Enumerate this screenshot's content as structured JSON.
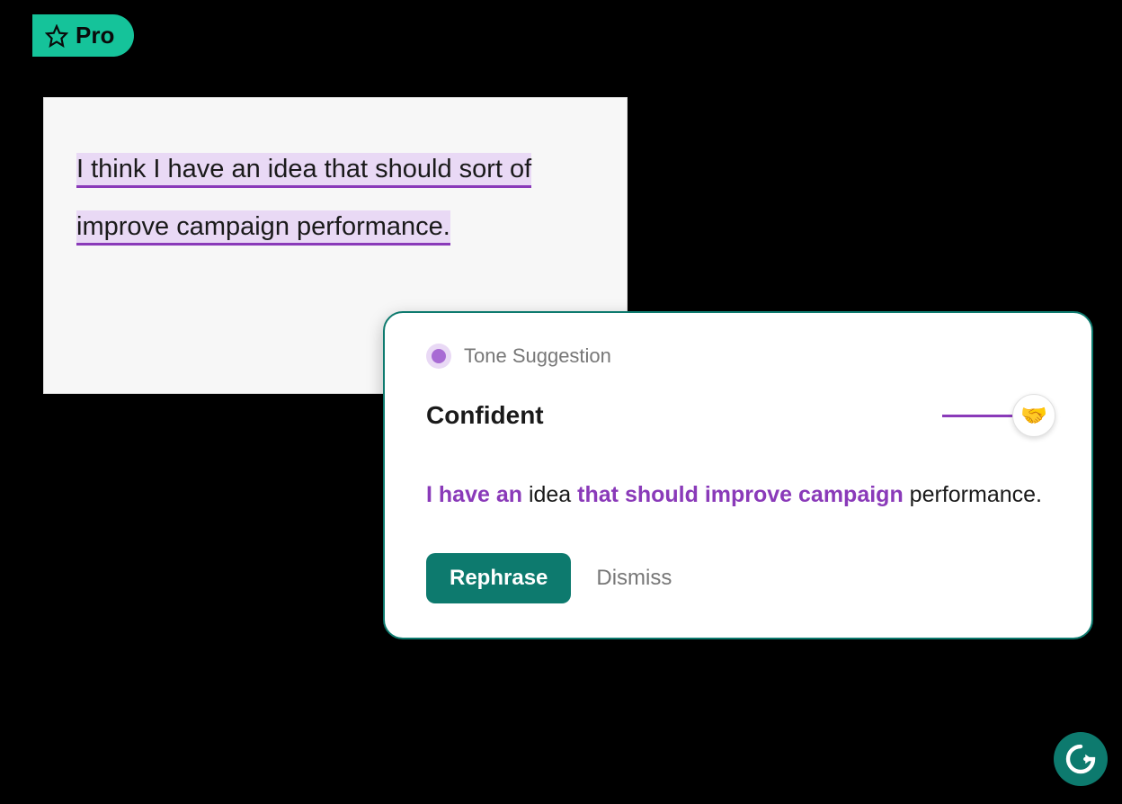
{
  "badge": {
    "label": "Pro"
  },
  "editor": {
    "line1": "I think I have an idea that should sort of",
    "line2": "improve campaign performance."
  },
  "suggestion": {
    "type_label": "Tone Suggestion",
    "tone_name": "Confident",
    "emoji": "🤝",
    "rephrased": {
      "p1": "I have an",
      "p2": " idea ",
      "p3": "that should improve campaign",
      "p4": " performance."
    },
    "actions": {
      "primary": "Rephrase",
      "secondary": "Dismiss"
    }
  }
}
